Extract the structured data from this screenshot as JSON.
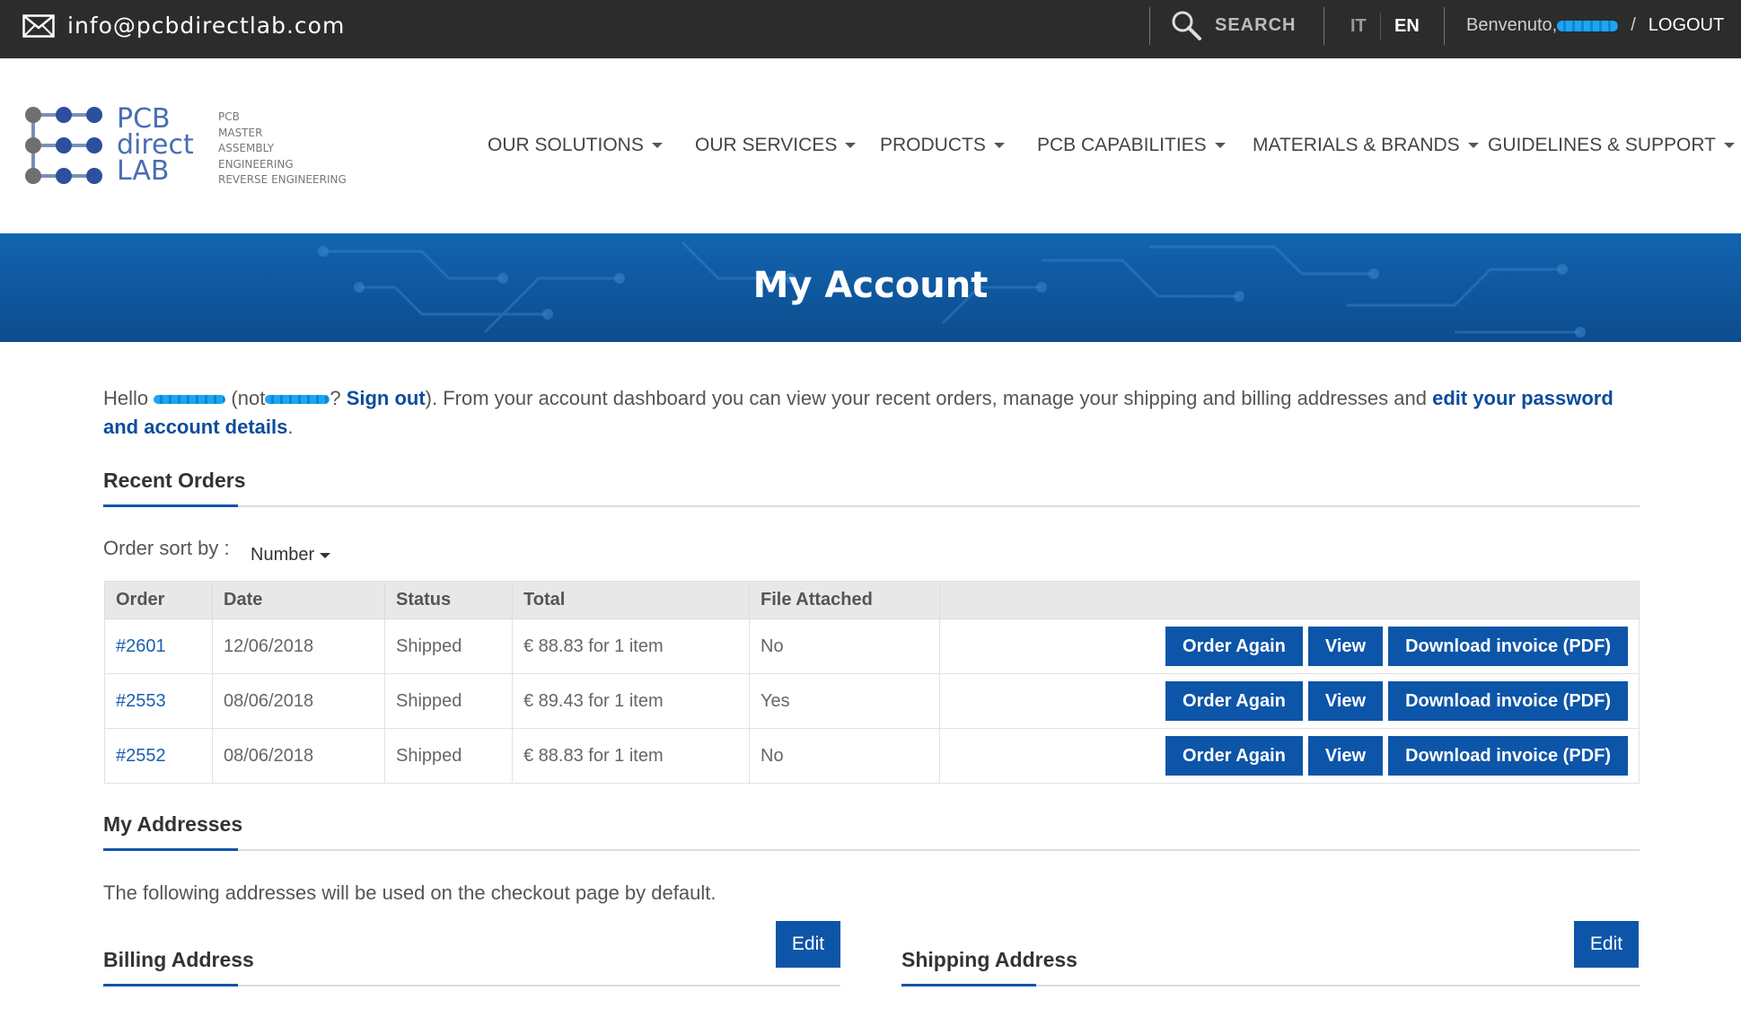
{
  "topbar": {
    "email": "info@pcbdirectlab.com",
    "search_label": "SEARCH",
    "lang_it": "IT",
    "lang_en": "EN",
    "welcome": "Benvenuto,",
    "separator": "/",
    "logout": "LOGOUT"
  },
  "logo": {
    "name_lines": [
      "PCB",
      "direct",
      "LAB"
    ],
    "tagline": [
      "PCB",
      "MASTER",
      "ASSEMBLY",
      "ENGINEERING",
      "REVERSE ENGINEERING"
    ]
  },
  "nav": [
    {
      "label": "OUR SOLUTIONS"
    },
    {
      "label": "OUR SERVICES"
    },
    {
      "label": "PRODUCTS"
    },
    {
      "label": "PCB CAPABILITIES"
    },
    {
      "label": "MATERIALS & BRANDS"
    },
    {
      "label": "GUIDELINES & SUPPORT"
    }
  ],
  "banner": {
    "title": "My Account"
  },
  "intro": {
    "hello": "Hello",
    "not_open": "(not",
    "q_mark": "?",
    "sign_out": "Sign out",
    "middle": "). From your account dashboard you can view your recent orders, manage your shipping and billing addresses and",
    "edit_link": "edit your password and account details",
    "end": "."
  },
  "recent_orders": {
    "heading": "Recent Orders",
    "sort_label": "Order sort by :",
    "sort_value": "Number",
    "columns": [
      "Order",
      "Date",
      "Status",
      "Total",
      "File Attached",
      ""
    ],
    "rows": [
      {
        "order": "#2601",
        "date": "12/06/2018",
        "status": "Shipped",
        "total": "€ 88.83 for 1 item",
        "file": "No"
      },
      {
        "order": "#2553",
        "date": "08/06/2018",
        "status": "Shipped",
        "total": "€ 89.43 for 1 item",
        "file": "Yes"
      },
      {
        "order": "#2552",
        "date": "08/06/2018",
        "status": "Shipped",
        "total": "€ 88.83 for 1 item",
        "file": "No"
      }
    ],
    "actions": {
      "order_again": "Order Again",
      "view": "View",
      "invoice": "Download invoice (PDF)"
    }
  },
  "addresses": {
    "heading": "My Addresses",
    "note": "The following addresses will be used on the checkout page by default.",
    "billing_heading": "Billing Address",
    "shipping_heading": "Shipping Address",
    "edit_label": "Edit"
  },
  "colors": {
    "topbar": "#2c2c2c",
    "brand_blue": "#0d55a8",
    "banner": "#1264b0"
  }
}
